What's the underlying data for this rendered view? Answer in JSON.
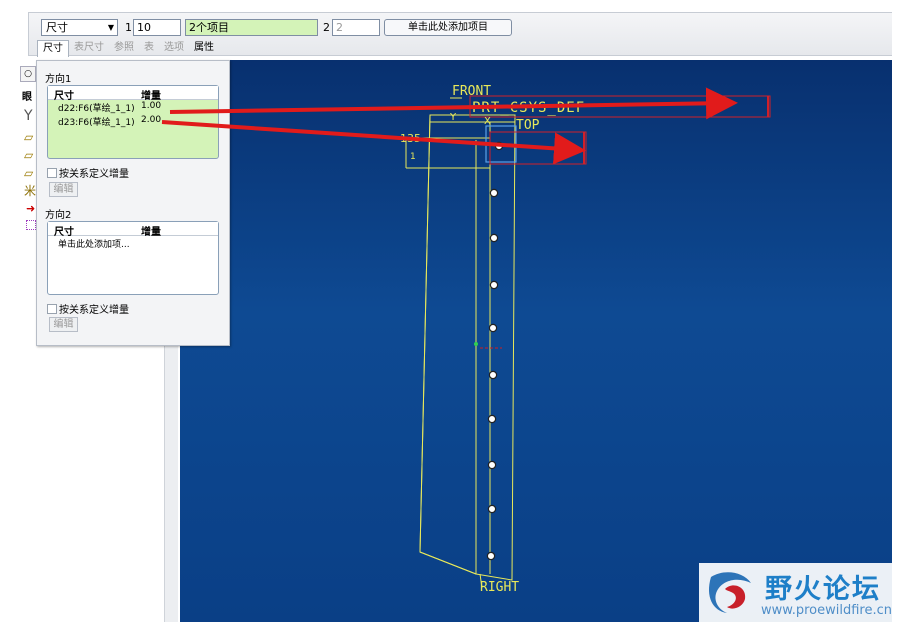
{
  "toolbar": {
    "type_dropdown": "尺寸",
    "dir1_label": "1",
    "dir1_count": "10",
    "dir1_items": "2个项目",
    "dir2_label": "2",
    "dir2_count": "2",
    "add_item_button": "单击此处添加项目",
    "tabs": [
      "尺寸",
      "表尺寸",
      "参照",
      "表",
      "选项",
      "属性"
    ]
  },
  "tree": {
    "tab_icon": "○",
    "header_text": "眼",
    "glyph_y": "Y",
    "glyph_star": "米"
  },
  "panel": {
    "direction1": {
      "title": "方向1",
      "col_dim": "尺寸",
      "col_inc": "增量",
      "rows": [
        {
          "dim": "d22:F6(草绘_1_1)",
          "inc": "1.00"
        },
        {
          "dim": "d23:F6(草绘_1_1)",
          "inc": "2.00"
        }
      ],
      "checkbox_label": "按关系定义增量",
      "edit_button": "编辑"
    },
    "direction2": {
      "title": "方向2",
      "col_dim": "尺寸",
      "col_inc": "增量",
      "placeholder": "单击此处添加项...",
      "checkbox_label": "按关系定义增量",
      "edit_button": "编辑"
    }
  },
  "viewport": {
    "label_front": "FRONT",
    "label_csys": "PRT_CSYS_DEF",
    "label_top": "TOP",
    "label_right": "RIGHT",
    "label_y": "Y",
    "label_x": "X",
    "label_dim": "135",
    "label_small": "1"
  },
  "watermark": {
    "name": "野火论坛",
    "url": "www.proewildfire.cn"
  },
  "colors": {
    "annotation_arrow": "#e11b1b",
    "sketch_line": "#e8e85a",
    "viewport_bg": "#0b3a80",
    "selected_table": "#d4f3b8"
  }
}
